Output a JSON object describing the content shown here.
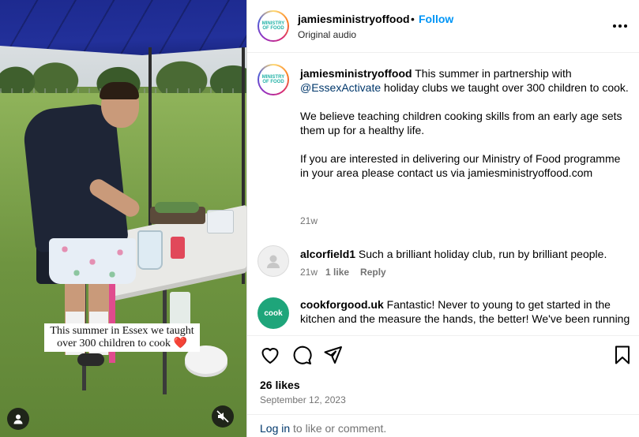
{
  "video": {
    "caption_line1": "This summer in Essex we taught",
    "caption_line2": "over 300 children to cook",
    "caption_emoji": "❤️",
    "user_icon": "user-icon",
    "mute_icon": "muted-speaker-icon"
  },
  "header": {
    "avatar_text": "MINISTRY OF FOOD",
    "username": "jamiesministryoffood",
    "separator": "•",
    "follow_label": "Follow",
    "audio": "Original audio",
    "more_icon": "more-options-icon"
  },
  "caption": {
    "username": "jamiesministryoffood",
    "p1_before": "This summer in partnership with",
    "mention": "@EssexActivate",
    "p1_after": "holiday clubs we taught over 300 children to cook.",
    "p2": "We believe teaching children cooking skills from an early age sets them up for a healthy life.",
    "p3": "If you are interested in delivering our Ministry of Food programme in your area please contact us via jamiesministryoffood.com",
    "time": "21w"
  },
  "comments": [
    {
      "username": "alcorfield1",
      "text": "Such a brilliant holiday club, run by brilliant people.",
      "time": "21w",
      "likes": "1 like",
      "reply": "Reply"
    },
    {
      "username": "cookforgood.uk",
      "avatar_text": "cook",
      "text": "Fantastic! Never to young to get started in the kitchen and the measure the hands, the better! We've been running"
    }
  ],
  "actions": {
    "like_icon": "heart-icon",
    "comment_icon": "comment-icon",
    "share_icon": "share-icon",
    "save_icon": "bookmark-icon",
    "likes": "26 likes",
    "date": "September 12, 2023"
  },
  "login": {
    "link": "Log in",
    "rest": "to like or comment."
  },
  "colors": {
    "link_blue": "#0095f6",
    "mention_blue": "#00376b",
    "muted": "#737373"
  }
}
